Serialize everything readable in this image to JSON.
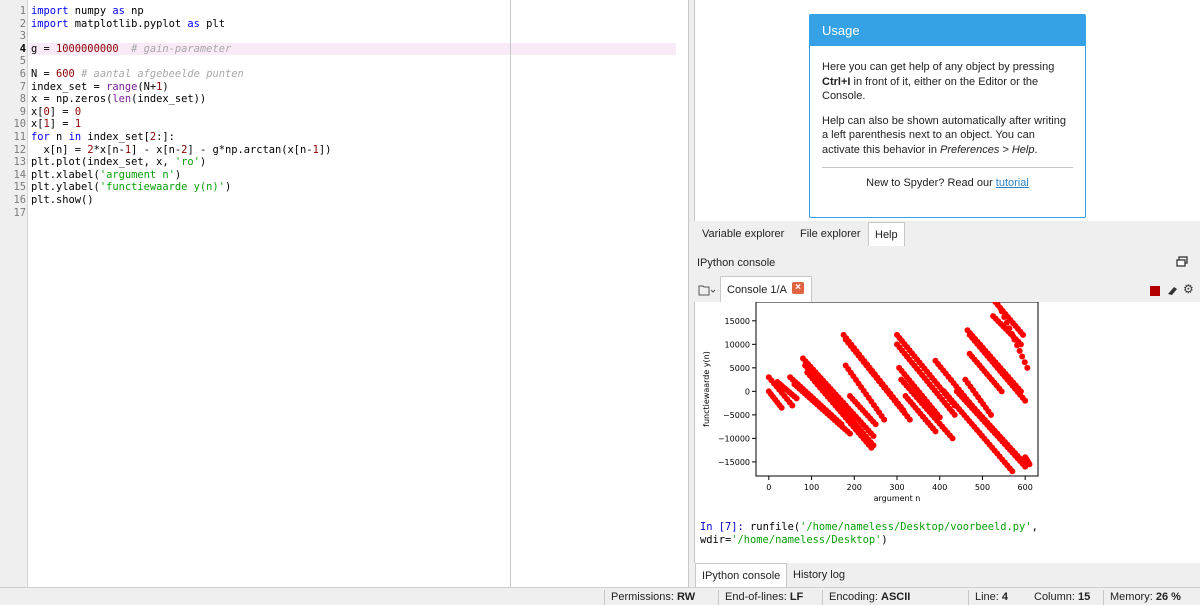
{
  "editor": {
    "lines": [
      {
        "n": "1",
        "code": [
          [
            "k",
            "import"
          ],
          [
            "t",
            " numpy "
          ],
          [
            "k",
            "as"
          ],
          [
            "t",
            " np"
          ]
        ]
      },
      {
        "n": "2",
        "code": [
          [
            "k",
            "import"
          ],
          [
            "t",
            " matplotlib.pyplot "
          ],
          [
            "k",
            "as"
          ],
          [
            "t",
            " plt"
          ]
        ]
      },
      {
        "n": "3",
        "code": []
      },
      {
        "n": "4",
        "code": [
          [
            "t",
            "g = "
          ],
          [
            "n",
            "1000000000"
          ],
          [
            "t",
            "  "
          ],
          [
            "c",
            "# gain-parameter"
          ]
        ]
      },
      {
        "n": "5",
        "code": []
      },
      {
        "n": "6",
        "code": [
          [
            "t",
            "N = "
          ],
          [
            "n",
            "600"
          ],
          [
            "t",
            " "
          ],
          [
            "c",
            "# aantal afgebeelde punten"
          ]
        ]
      },
      {
        "n": "7",
        "code": [
          [
            "t",
            "index_set = "
          ],
          [
            "b",
            "range"
          ],
          [
            "t",
            "(N+"
          ],
          [
            "n",
            "1"
          ],
          [
            "t",
            ")"
          ]
        ]
      },
      {
        "n": "8",
        "code": [
          [
            "t",
            "x = np.zeros("
          ],
          [
            "b",
            "len"
          ],
          [
            "t",
            "(index_set))"
          ]
        ]
      },
      {
        "n": "9",
        "code": [
          [
            "t",
            "x["
          ],
          [
            "n",
            "0"
          ],
          [
            "t",
            "] = "
          ],
          [
            "n",
            "0"
          ]
        ]
      },
      {
        "n": "10",
        "code": [
          [
            "t",
            "x["
          ],
          [
            "n",
            "1"
          ],
          [
            "t",
            "] = "
          ],
          [
            "n",
            "1"
          ]
        ]
      },
      {
        "n": "11",
        "code": [
          [
            "k",
            "for"
          ],
          [
            "t",
            " n "
          ],
          [
            "k",
            "in"
          ],
          [
            "t",
            " index_set["
          ],
          [
            "n",
            "2"
          ],
          [
            "t",
            ":]:"
          ]
        ]
      },
      {
        "n": "12",
        "code": [
          [
            "t",
            "  x[n] = "
          ],
          [
            "n",
            "2"
          ],
          [
            "t",
            "*x[n-"
          ],
          [
            "n",
            "1"
          ],
          [
            "t",
            "] - x[n-"
          ],
          [
            "n",
            "2"
          ],
          [
            "t",
            "] - g*np.arctan(x[n-"
          ],
          [
            "n",
            "1"
          ],
          [
            "t",
            "])"
          ]
        ]
      },
      {
        "n": "13",
        "code": [
          [
            "t",
            "plt.plot(index_set, x, "
          ],
          [
            "s",
            "'ro'"
          ],
          [
            "t",
            ")"
          ]
        ]
      },
      {
        "n": "14",
        "code": [
          [
            "t",
            "plt.xlabel("
          ],
          [
            "s",
            "'argument n'"
          ],
          [
            "t",
            ")"
          ]
        ]
      },
      {
        "n": "15",
        "code": [
          [
            "t",
            "plt.ylabel("
          ],
          [
            "s",
            "'functiewaarde y(n)'"
          ],
          [
            "t",
            ")"
          ]
        ]
      },
      {
        "n": "16",
        "code": [
          [
            "t",
            "plt.show()"
          ]
        ]
      },
      {
        "n": "17",
        "code": []
      }
    ]
  },
  "help": {
    "title": "Usage",
    "p1_a": "Here you can get help of any object by pressing ",
    "p1_bold": "Ctrl+I",
    "p1_b": " in front of it, either on the Editor or the Console.",
    "p2_a": "Help can also be shown automatically after writing a left parenthesis next to an object. You can activate this behavior in ",
    "p2_italic": "Preferences > Help",
    "p2_b": ".",
    "footer_text": "New to Spyder? Read our ",
    "footer_link": "tutorial"
  },
  "top_tabs": [
    "Variable explorer",
    "File explorer",
    "Help"
  ],
  "console": {
    "pane_title": "IPython console",
    "tab_label": "Console 1/A",
    "prompt": "In [7]:",
    "command": " runfile('/home/nameless/Desktop/voorbeeld.py', wdir='/home/nameless/Desktop')",
    "cmd_pre": " runfile(",
    "cmd_str1": "'/home/nameless/Desktop/voorbeeld.py'",
    "cmd_mid": ", wdir=",
    "cmd_str2": "'/home/nameless/Desktop'",
    "cmd_post": ")"
  },
  "bottom_tabs": [
    "IPython console",
    "History log"
  ],
  "statusbar": {
    "permissions_label": "Permissions:",
    "permissions": "RW",
    "eol_label": "End-of-lines:",
    "eol": "LF",
    "encoding_label": "Encoding:",
    "encoding": "ASCII",
    "line_label": "Line:",
    "line": "4",
    "column_label": "Column:",
    "column": "15",
    "memory_label": "Memory:",
    "memory": "26 %"
  },
  "colors": {
    "accent": "#34a2e5",
    "marker": "#ff0000",
    "stop": "#b40000"
  },
  "chart_data": {
    "type": "scatter",
    "series": [
      {
        "name": "",
        "color": "#ff0000"
      }
    ],
    "xlabel": "argument n",
    "ylabel": "functiewaarde y(n)",
    "xlim": [
      -30,
      630
    ],
    "ylim": [
      -18000,
      19000
    ],
    "xticks": [
      0,
      100,
      200,
      300,
      400,
      500,
      600
    ],
    "xtick_labels": [
      "0",
      "100",
      "200",
      "300",
      "400",
      "500",
      "600"
    ],
    "yticks": [
      15000,
      10000,
      5000,
      0,
      -5000,
      -10000,
      -15000
    ],
    "ytick_labels": [
      "15000",
      "10000",
      "5000",
      "0",
      "−5000",
      "−10000",
      "−15000"
    ],
    "segments": [
      {
        "x": [
          0,
          30
        ],
        "y": [
          0,
          -3500
        ]
      },
      {
        "x": [
          0,
          55
        ],
        "y": [
          3000,
          -3000
        ]
      },
      {
        "x": [
          20,
          65
        ],
        "y": [
          2000,
          -1500
        ]
      },
      {
        "x": [
          50,
          170
        ],
        "y": [
          3000,
          -7000
        ]
      },
      {
        "x": [
          60,
          190
        ],
        "y": [
          1500,
          -9000
        ]
      },
      {
        "x": [
          80,
          245
        ],
        "y": [
          7000,
          -9500
        ]
      },
      {
        "x": [
          85,
          245
        ],
        "y": [
          5500,
          -11500
        ]
      },
      {
        "x": [
          90,
          240
        ],
        "y": [
          4000,
          -12000
        ]
      },
      {
        "x": [
          175,
          315
        ],
        "y": [
          12000,
          -4000
        ]
      },
      {
        "x": [
          180,
          330
        ],
        "y": [
          11000,
          -6000
        ]
      },
      {
        "x": [
          180,
          270
        ],
        "y": [
          5500,
          -6000
        ]
      },
      {
        "x": [
          190,
          250
        ],
        "y": [
          -1000,
          -7000
        ]
      },
      {
        "x": [
          300,
          435
        ],
        "y": [
          12000,
          -3000
        ]
      },
      {
        "x": [
          300,
          435
        ],
        "y": [
          10000,
          -5000
        ]
      },
      {
        "x": [
          305,
          400
        ],
        "y": [
          5000,
          -5500
        ]
      },
      {
        "x": [
          310,
          430
        ],
        "y": [
          2500,
          -10000
        ]
      },
      {
        "x": [
          320,
          390
        ],
        "y": [
          -1000,
          -8500
        ]
      },
      {
        "x": [
          390,
          475
        ],
        "y": [
          6500,
          -3000
        ]
      },
      {
        "x": [
          410,
          570
        ],
        "y": [
          0,
          -17000
        ]
      },
      {
        "x": [
          440,
          600
        ],
        "y": [
          0,
          -16000
        ]
      },
      {
        "x": [
          470,
          600
        ],
        "y": [
          -2500,
          -15500
        ]
      },
      {
        "x": [
          460,
          520
        ],
        "y": [
          2500,
          -5000
        ]
      },
      {
        "x": [
          465,
          590
        ],
        "y": [
          13000,
          0
        ]
      },
      {
        "x": [
          470,
          600
        ],
        "y": [
          12000,
          -2000
        ]
      },
      {
        "x": [
          470,
          545
        ],
        "y": [
          8000,
          0
        ]
      },
      {
        "x": [
          530,
          595
        ],
        "y": [
          19000,
          12000
        ]
      },
      {
        "x": [
          545,
          605
        ],
        "y": [
          17000,
          5000
        ]
      },
      {
        "x": [
          525,
          590
        ],
        "y": [
          16000,
          10000
        ]
      },
      {
        "x": [
          600,
          610
        ],
        "y": [
          -14000,
          -15500
        ]
      }
    ]
  }
}
